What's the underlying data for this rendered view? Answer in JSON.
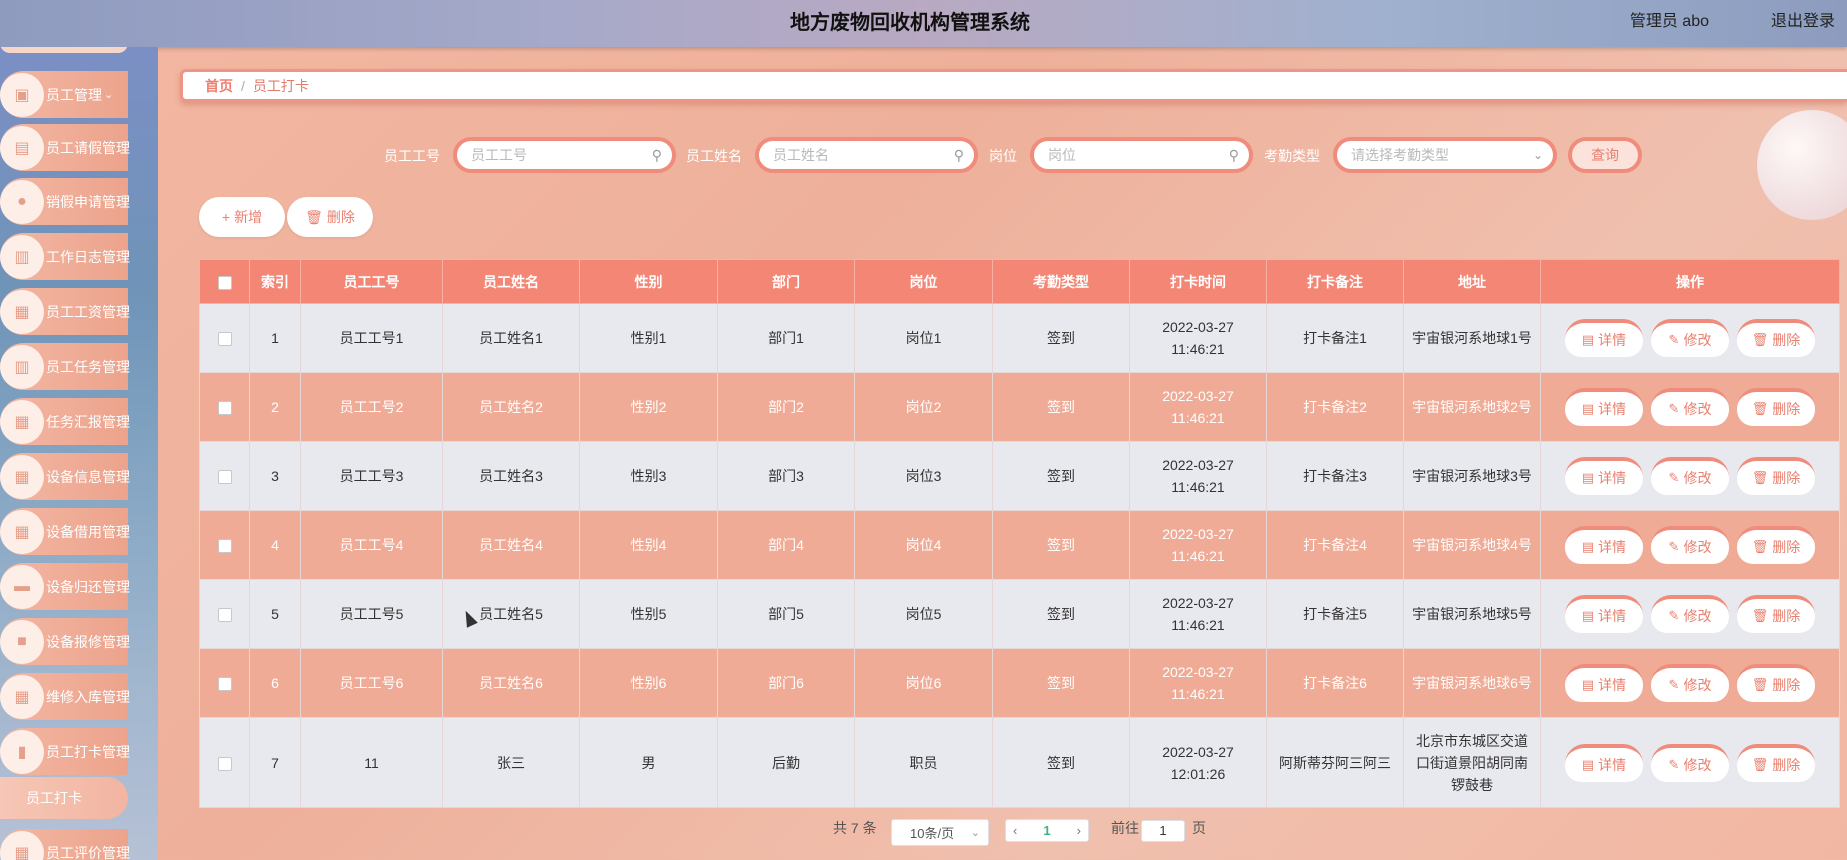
{
  "header": {
    "title": "地方废物回收机构管理系统",
    "user": "管理员 abo",
    "logout": "退出登录"
  },
  "sidebar": {
    "items": [
      {
        "label": "员工管理",
        "icon": "image-icon",
        "has_submenu": true
      },
      {
        "label": "员工请假管理",
        "icon": "briefcase-icon"
      },
      {
        "label": "销假申请管理",
        "icon": "location-pin-icon"
      },
      {
        "label": "工作日志管理",
        "icon": "clipboard-icon"
      },
      {
        "label": "员工工资管理",
        "icon": "grid-icon"
      },
      {
        "label": "员工任务管理",
        "icon": "clipboard-icon"
      },
      {
        "label": "任务汇报管理",
        "icon": "grid-icon"
      },
      {
        "label": "设备信息管理",
        "icon": "grid-icon"
      },
      {
        "label": "设备借用管理",
        "icon": "grid-icon"
      },
      {
        "label": "设备归还管理",
        "icon": "chat-icon"
      },
      {
        "label": "设备报修管理",
        "icon": "book-icon"
      },
      {
        "label": "维修入库管理",
        "icon": "grid-icon"
      },
      {
        "label": "员工打卡管理",
        "icon": "bar-chart-icon"
      }
    ],
    "active_submenu": "员工打卡",
    "bottom_partial": "员工评价管理"
  },
  "breadcrumb": {
    "home": "首页",
    "separator": "/",
    "current": "员工打卡"
  },
  "search": {
    "fields": [
      {
        "label": "员工工号",
        "placeholder": "员工工号"
      },
      {
        "label": "员工姓名",
        "placeholder": "员工姓名"
      },
      {
        "label": "岗位",
        "placeholder": "岗位"
      }
    ],
    "attendance": {
      "label": "考勤类型",
      "placeholder": "请选择考勤类型"
    },
    "query_label": "查询"
  },
  "actions": {
    "add_label": "新增",
    "delete_label": "删除"
  },
  "table": {
    "headers": [
      "索引",
      "员工工号",
      "员工姓名",
      "性别",
      "部门",
      "岗位",
      "考勤类型",
      "打卡时间",
      "打卡备注",
      "地址",
      "操作"
    ],
    "rows": [
      {
        "index": "1",
        "emp_no": "员工工号1",
        "name": "员工姓名1",
        "gender": "性别1",
        "dept": "部门1",
        "post": "岗位1",
        "type": "签到",
        "time": "2022-03-27 11:46:21",
        "note": "打卡备注1",
        "addr": "宇宙银河系地球1号"
      },
      {
        "index": "2",
        "emp_no": "员工工号2",
        "name": "员工姓名2",
        "gender": "性别2",
        "dept": "部门2",
        "post": "岗位2",
        "type": "签到",
        "time": "2022-03-27 11:46:21",
        "note": "打卡备注2",
        "addr": "宇宙银河系地球2号"
      },
      {
        "index": "3",
        "emp_no": "员工工号3",
        "name": "员工姓名3",
        "gender": "性别3",
        "dept": "部门3",
        "post": "岗位3",
        "type": "签到",
        "time": "2022-03-27 11:46:21",
        "note": "打卡备注3",
        "addr": "宇宙银河系地球3号"
      },
      {
        "index": "4",
        "emp_no": "员工工号4",
        "name": "员工姓名4",
        "gender": "性别4",
        "dept": "部门4",
        "post": "岗位4",
        "type": "签到",
        "time": "2022-03-27 11:46:21",
        "note": "打卡备注4",
        "addr": "宇宙银河系地球4号"
      },
      {
        "index": "5",
        "emp_no": "员工工号5",
        "name": "员工姓名5",
        "gender": "性别5",
        "dept": "部门5",
        "post": "岗位5",
        "type": "签到",
        "time": "2022-03-27 11:46:21",
        "note": "打卡备注5",
        "addr": "宇宙银河系地球5号"
      },
      {
        "index": "6",
        "emp_no": "员工工号6",
        "name": "员工姓名6",
        "gender": "性别6",
        "dept": "部门6",
        "post": "岗位6",
        "type": "签到",
        "time": "2022-03-27 11:46:21",
        "note": "打卡备注6",
        "addr": "宇宙银河系地球6号"
      },
      {
        "index": "7",
        "emp_no": "11",
        "name": "张三",
        "gender": "男",
        "dept": "后勤",
        "post": "职员",
        "type": "签到",
        "time": "2022-03-27 12:01:26",
        "note": "阿斯蒂芬阿三阿三",
        "addr": "北京市东城区交道口街道景阳胡同南锣鼓巷"
      }
    ],
    "row_actions": {
      "detail": "详情",
      "edit": "修改",
      "delete": "删除"
    }
  },
  "pagination": {
    "total": "共 7 条",
    "page_size": "10条/页",
    "current_page": "1",
    "goto_prefix": "前往",
    "goto_value": "1",
    "goto_suffix": "页"
  },
  "colors": {
    "accent": "#f48676",
    "accent_border": "#f08c7c",
    "row_alt": "#f0ab97",
    "row_base": "#e8e8ef"
  }
}
